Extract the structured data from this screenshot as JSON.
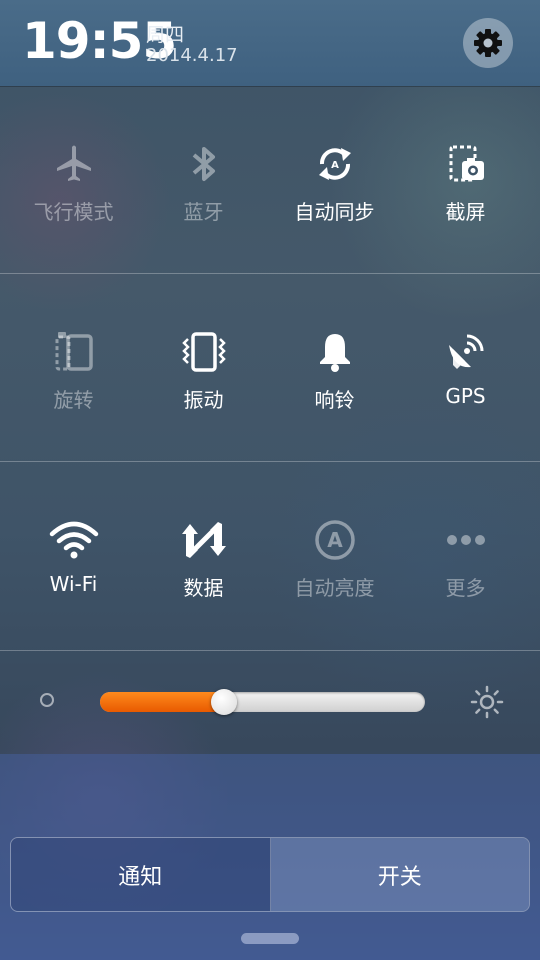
{
  "status": {
    "time": "19:55",
    "weekday": "周四",
    "date": "2014.4.17"
  },
  "toggles": [
    {
      "label": "飞行模式",
      "icon": "airplane-icon",
      "state": "off"
    },
    {
      "label": "蓝牙",
      "icon": "bluetooth-icon",
      "state": "off"
    },
    {
      "label": "自动同步",
      "icon": "auto-sync-icon",
      "state": "on"
    },
    {
      "label": "截屏",
      "icon": "screenshot-icon",
      "state": "on"
    },
    {
      "label": "旋转",
      "icon": "rotate-icon",
      "state": "off"
    },
    {
      "label": "振动",
      "icon": "vibrate-icon",
      "state": "on"
    },
    {
      "label": "响铃",
      "icon": "bell-icon",
      "state": "on"
    },
    {
      "label": "GPS",
      "icon": "gps-icon",
      "state": "on"
    },
    {
      "label": "Wi-Fi",
      "icon": "wifi-icon",
      "state": "on"
    },
    {
      "label": "数据",
      "icon": "data-icon",
      "state": "on"
    },
    {
      "label": "自动亮度",
      "icon": "auto-brightness-icon",
      "state": "off"
    },
    {
      "label": "更多",
      "icon": "more-icon",
      "state": "off"
    }
  ],
  "brightness": {
    "level": 0.38,
    "fill_color": "#f06a0a"
  },
  "tabs": {
    "notifications": "通知",
    "switches": "开关",
    "selected": "switches"
  }
}
